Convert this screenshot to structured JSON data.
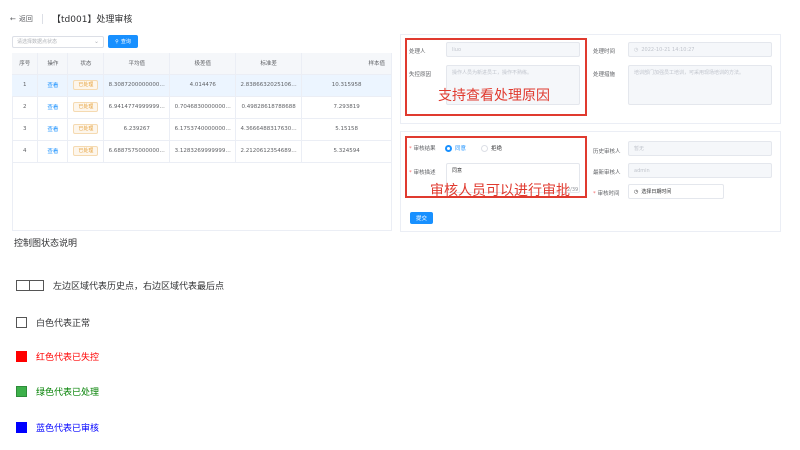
{
  "header": {
    "back_label": "返回",
    "title": "【td001】处理审核"
  },
  "filter": {
    "placeholder": "请选择数据点状态",
    "query_label": "查询"
  },
  "table": {
    "columns": [
      "序号",
      "操作",
      "状态",
      "平均值",
      "极差值",
      "标准差",
      "样本值"
    ],
    "rows": [
      {
        "idx": "1",
        "op": "查看",
        "status": "已处理",
        "avg": "8.3087200000000…",
        "range": "4.014476",
        "std": "2.8386632025106…",
        "sample": "10.315958"
      },
      {
        "idx": "2",
        "op": "查看",
        "status": "已处理",
        "avg": "6.9414774999999…",
        "range": "0.7046830000000…",
        "std": "0.49828618788688",
        "sample": "7.293819"
      },
      {
        "idx": "3",
        "op": "查看",
        "status": "已处理",
        "avg": "6.239267",
        "range": "6.1753740000000…",
        "std": "4.3666488317630…",
        "sample": "5.15158"
      },
      {
        "idx": "4",
        "op": "查看",
        "status": "已处理",
        "avg": "6.6887575000000…",
        "range": "3.1283269999999…",
        "std": "2.2120612354689…",
        "sample": "5.324594"
      }
    ]
  },
  "detail": {
    "handler_label": "处理人",
    "handler_value": "liuo",
    "handle_time_label": "处理时间",
    "handle_time_value": "2022-10-21 14:10:27",
    "reason_label": "失控原因",
    "reason_placeholder": "操作人员为新进员工，操作不熟练。",
    "measure_label": "处理措施",
    "measure_placeholder": "培训部门加强员工培训，可采用现场培训的方法。",
    "annotation": "支持查看处理原因"
  },
  "review": {
    "result_label": "审核结果",
    "agree_label": "同意",
    "reject_label": "拒绝",
    "history_label": "历史审核人",
    "history_value": "暂无",
    "desc_label": "审核描述",
    "desc_value": "同意",
    "latest_label": "最新审核人",
    "latest_value": "admin",
    "time_label": "审核时间",
    "time_placeholder": "选择日期时间",
    "count": "2/39",
    "annotation": "审核人员可以进行审批",
    "submit_label": "提交"
  },
  "legend": {
    "title": "控制图状态说明",
    "items": [
      {
        "text": "左边区域代表历史点，右边区域代表最后点",
        "color": "#303133",
        "box": "#ffffff"
      },
      {
        "text": "白色代表正常",
        "color": "#303133",
        "box": "#ffffff"
      },
      {
        "text": "红色代表已失控",
        "color": "#ff0000",
        "box": "#ff0000"
      },
      {
        "text": "绿色代表已处理",
        "color": "#008000",
        "box": "#3cb04a"
      },
      {
        "text": "蓝色代表已审核",
        "color": "#0000ff",
        "box": "#0000ff"
      }
    ]
  },
  "colors": {
    "primary": "#1890ff",
    "annotation_red": "#e03a2f"
  }
}
